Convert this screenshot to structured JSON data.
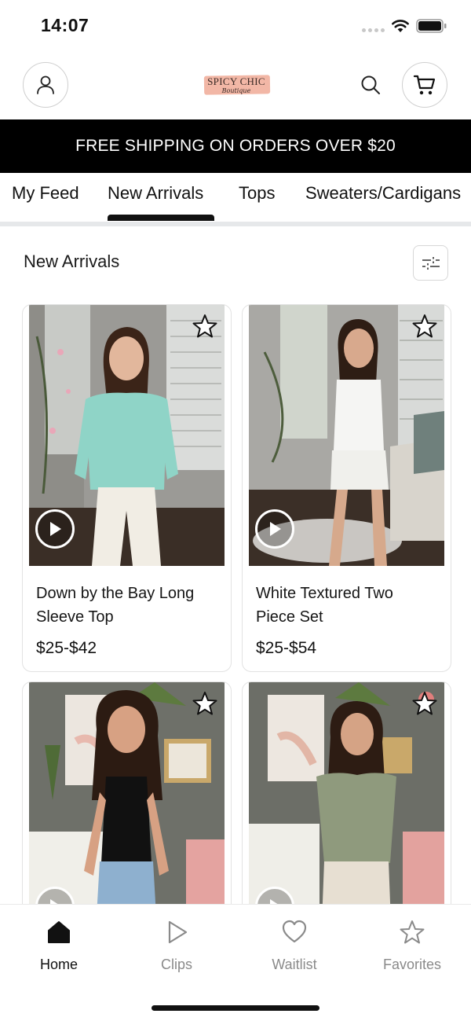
{
  "status_bar": {
    "time": "14:07"
  },
  "header": {
    "logo_text": "SPICY CHIC",
    "logo_subtext": "Boutique",
    "account_icon": "person-icon",
    "search_icon": "search-icon",
    "cart_icon": "cart-icon"
  },
  "banner": {
    "text": "FREE SHIPPING ON ORDERS OVER $20"
  },
  "tabs": [
    {
      "label": "My Feed"
    },
    {
      "label": "New Arrivals",
      "active": true
    },
    {
      "label": "Tops"
    },
    {
      "label": "Sweaters/Cardigans"
    }
  ],
  "section": {
    "title": "New Arrivals",
    "filter_icon": "sliders-icon"
  },
  "products": [
    {
      "name": "Down by the Bay Long Sleeve Top",
      "price": "$25-$42",
      "has_video": true,
      "favorite": false
    },
    {
      "name": "White Textured Two Piece Set",
      "price": "$25-$54",
      "has_video": true,
      "favorite": false
    },
    {
      "name": "",
      "price": "",
      "has_video": true,
      "favorite": false
    },
    {
      "name": "",
      "price": "",
      "has_video": true,
      "favorite": false
    }
  ],
  "bottom_nav": [
    {
      "label": "Home",
      "icon": "home-icon",
      "active": true
    },
    {
      "label": "Clips",
      "icon": "play-icon",
      "active": false
    },
    {
      "label": "Waitlist",
      "icon": "heart-icon",
      "active": false
    },
    {
      "label": "Favorites",
      "icon": "star-icon",
      "active": false
    }
  ],
  "colors": {
    "banner_bg": "#000000",
    "banner_text": "#ffffff",
    "accent": "#111111",
    "inactive_nav": "#8a8a8a",
    "logo_pink": "#f2b7a6"
  }
}
